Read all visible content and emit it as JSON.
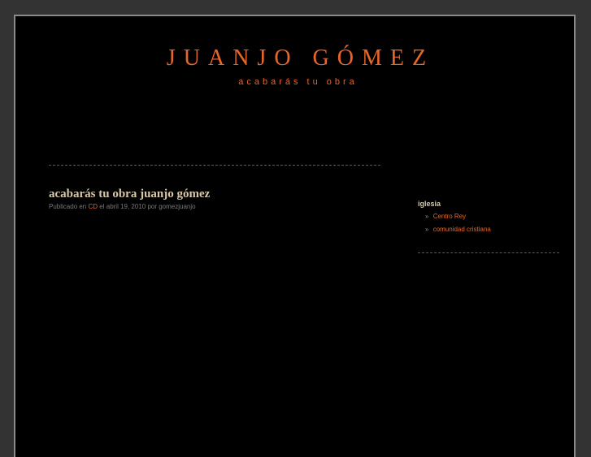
{
  "header": {
    "title": "JUANJO GÓMEZ",
    "tagline": "acabarás tu obra"
  },
  "post": {
    "title": "acabarás tu obra juanjo gómez",
    "meta_prefix": "Publicado en",
    "category": "CD",
    "meta_suffix": "el abril 19, 2010 por gomezjuanjo"
  },
  "sidebar": {
    "heading": "iglesia",
    "links": [
      {
        "bullet": "»",
        "label": "Centro Rey"
      },
      {
        "bullet": "»",
        "label": "comunidad cristiana"
      }
    ]
  },
  "colors": {
    "accent": "#e8652a",
    "heading": "#d8c8a8",
    "meta": "#7a7a7a",
    "background": "#000000",
    "outer": "#333333"
  }
}
